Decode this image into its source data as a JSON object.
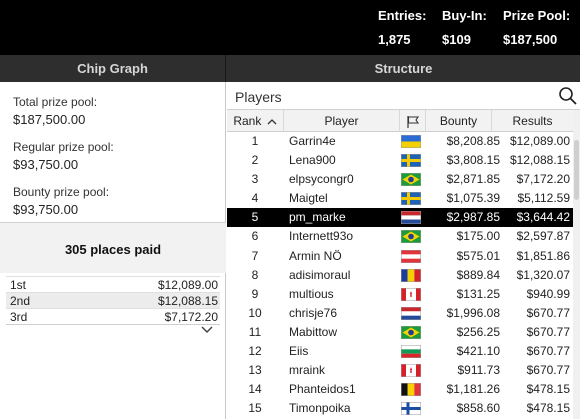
{
  "header": {
    "entries_label": "Entries:",
    "entries_value": "1,875",
    "buyin_label": "Buy-In:",
    "buyin_value": "$109",
    "prizepool_label": "Prize Pool:",
    "prizepool_value": "$187,500"
  },
  "tabs": {
    "chip_graph": "Chip Graph",
    "structure": "Structure"
  },
  "prizes": {
    "total_label": "Total prize pool:",
    "total_value": "$187,500.00",
    "regular_label": "Regular prize pool:",
    "regular_value": "$93,750.00",
    "bounty_label": "Bounty prize pool:",
    "bounty_value": "$93,750.00",
    "paid_title": "305 places paid",
    "places": [
      {
        "pos": "1st",
        "amount": "$12,089.00"
      },
      {
        "pos": "2nd",
        "amount": "$12,088.15"
      },
      {
        "pos": "3rd",
        "amount": "$7,172.20"
      }
    ]
  },
  "players_panel": {
    "search_label": "Players",
    "columns": {
      "rank": "Rank",
      "player": "Player",
      "bounty": "Bounty",
      "results": "Results"
    },
    "rows": [
      {
        "rank": "1",
        "player": "Garrin4e",
        "flag": "ukraine",
        "bounty": "$8,208.85",
        "result": "$12,089.00"
      },
      {
        "rank": "2",
        "player": "Lena900",
        "flag": "sweden",
        "bounty": "$3,808.15",
        "result": "$12,088.15"
      },
      {
        "rank": "3",
        "player": "elpsycongr0",
        "flag": "brazil",
        "bounty": "$2,871.85",
        "result": "$7,172.20"
      },
      {
        "rank": "4",
        "player": "Maigtel",
        "flag": "sweden",
        "bounty": "$1,075.39",
        "result": "$5,112.59"
      },
      {
        "rank": "5",
        "player": "pm_marke",
        "flag": "netherlands",
        "bounty": "$2,987.85",
        "result": "$3,644.42",
        "selected": true
      },
      {
        "rank": "6",
        "player": "Internett93o",
        "flag": "brazil",
        "bounty": "$175.00",
        "result": "$2,597.87"
      },
      {
        "rank": "7",
        "player": "Armin NÖ",
        "flag": "austria",
        "bounty": "$575.01",
        "result": "$1,851.86"
      },
      {
        "rank": "8",
        "player": "adisimoraul",
        "flag": "romania",
        "bounty": "$889.84",
        "result": "$1,320.07"
      },
      {
        "rank": "9",
        "player": "multious",
        "flag": "canada",
        "bounty": "$131.25",
        "result": "$940.99"
      },
      {
        "rank": "10",
        "player": "chrisje76",
        "flag": "netherlands",
        "bounty": "$1,996.08",
        "result": "$670.77"
      },
      {
        "rank": "11",
        "player": "Mabittow",
        "flag": "brazil",
        "bounty": "$256.25",
        "result": "$670.77"
      },
      {
        "rank": "12",
        "player": "Eiis",
        "flag": "bulgaria",
        "bounty": "$421.10",
        "result": "$670.77"
      },
      {
        "rank": "13",
        "player": "mraink",
        "flag": "canada",
        "bounty": "$911.73",
        "result": "$670.77"
      },
      {
        "rank": "14",
        "player": "Phanteidos1",
        "flag": "belgium",
        "bounty": "$1,181.26",
        "result": "$478.15"
      },
      {
        "rank": "15",
        "player": "Timonpoika",
        "flag": "finland",
        "bounty": "$858.60",
        "result": "$478.15"
      }
    ]
  }
}
